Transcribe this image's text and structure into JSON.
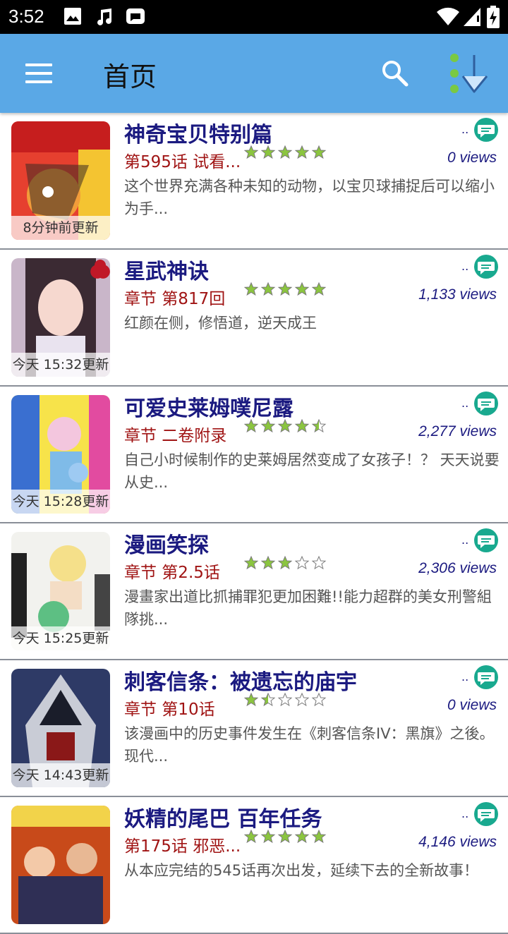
{
  "status": {
    "time": "3:52"
  },
  "appbar": {
    "title": "首页"
  },
  "colors": {
    "appbar": "#5aa8e6",
    "title_text": "#1b1a80",
    "chapter_text": "#a01414",
    "star_fill": "#8bc53f"
  },
  "items": [
    {
      "name": "神奇宝贝特别篇",
      "chapter": "第595话 试看...",
      "updated": "8分钟前更新",
      "rating": 5,
      "views": "0 views",
      "dots": "..",
      "desc": "这个世界充满各种未知的动物，以宝贝球捕捉后可以缩小为手..."
    },
    {
      "name": "星武神诀",
      "chapter": "章节 第817回",
      "updated": "今天 15:32更新",
      "rating": 5,
      "views": "1,133 views",
      "dots": "..",
      "desc": "红颜在侧，修悟道，逆天成王"
    },
    {
      "name": "可爱史莱姆噗尼露",
      "chapter": "章节 二卷附录",
      "updated": "今天 15:28更新",
      "rating": 4.5,
      "views": "2,277 views",
      "dots": "..",
      "desc": "自己小时候制作的史莱姆居然变成了女孩子！？ 天天说要从史..."
    },
    {
      "name": "漫画笑探",
      "chapter": "章节 第2.5话",
      "updated": "今天 15:25更新",
      "rating": 3,
      "views": "2,306 views",
      "dots": "..",
      "desc": "漫畫家出道比抓捕罪犯更加困難!!能力超群的美女刑警組隊挑..."
    },
    {
      "name": "刺客信条：被遗忘的庙宇",
      "chapter": "章节 第10话",
      "updated": "今天 14:43更新",
      "rating": 1.5,
      "views": "0 views",
      "dots": "..",
      "desc": "该漫画中的历史事件发生在《刺客信条IV：黑旗》之後。现代..."
    },
    {
      "name": "妖精的尾巴 百年任务",
      "chapter": "第175话 邪恶...",
      "updated": "",
      "rating": 5,
      "views": "4,146 views",
      "dots": "..",
      "desc": "从本应完结的545话再次出发，延续下去的全新故事！"
    }
  ]
}
